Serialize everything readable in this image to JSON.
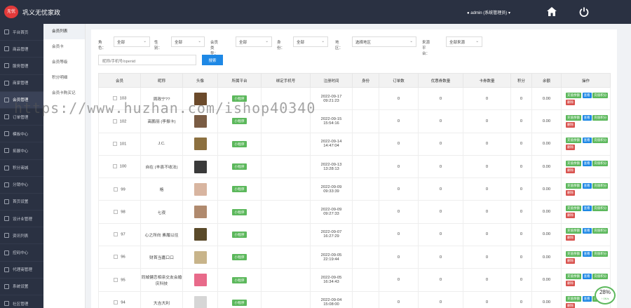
{
  "header": {
    "logo_text": "无忧",
    "brand": "巩义无忧家政",
    "admin": "admin (系统管理员)",
    "home_icon": "home-icon",
    "power_icon": "power-icon"
  },
  "sidebar": {
    "items": [
      {
        "label": "平台首页"
      },
      {
        "label": "商品管理"
      },
      {
        "label": "服务管理"
      },
      {
        "label": "商家管理"
      },
      {
        "label": "会员管理"
      },
      {
        "label": "订单管理"
      },
      {
        "label": "模板中心"
      },
      {
        "label": "拓展中心"
      },
      {
        "label": "积分商城"
      },
      {
        "label": "分销中心"
      },
      {
        "label": "首页设置"
      },
      {
        "label": "设计业管理"
      },
      {
        "label": "资讯列表"
      },
      {
        "label": "控码中心"
      },
      {
        "label": "代理商管理"
      },
      {
        "label": "系统设置"
      },
      {
        "label": "社区管理"
      }
    ]
  },
  "subnav": {
    "items": [
      {
        "label": "会员列表"
      },
      {
        "label": "会员卡"
      },
      {
        "label": "会员等级"
      },
      {
        "label": "积分明细"
      },
      {
        "label": "会员卡购买记"
      }
    ]
  },
  "filters": {
    "role_label": "角色：",
    "role_value": "全部",
    "gender_label": "性别：",
    "gender_value": "全部",
    "member_type_label": "会员类型：",
    "member_type_value": "全部",
    "identity_label": "身份：",
    "identity_value": "全部",
    "region_label": "地区：",
    "region_value": "选择地区",
    "source_label": "来源平台：",
    "source_value": "全部来源",
    "search_placeholder": "昵称/手机号/openid",
    "search_button": "搜索"
  },
  "table": {
    "headers": [
      "会员",
      "昵称",
      "头像",
      "所属平台",
      "绑定手机号",
      "注册时间",
      "身份",
      "订单数",
      "优惠券数量",
      "卡券数量",
      "积分",
      "余额",
      "操作"
    ],
    "rows": [
      {
        "id": "103",
        "nick": "周政宁??",
        "avatar": "#6b4a2b",
        "platform": "小程序",
        "phone": "",
        "date": "2022-09-17",
        "time": "09:21:23",
        "identity": "",
        "orders": "0",
        "coupons": "0",
        "cards": "0",
        "points": "0",
        "balance": "0.00"
      },
      {
        "id": "102",
        "nick": "高鹏丽 (李振卡)",
        "avatar": "#7a5c44",
        "platform": "小程序",
        "phone": "",
        "date": "2022-09-15",
        "time": "15:54:16",
        "identity": "",
        "orders": "0",
        "coupons": "0",
        "cards": "0",
        "points": "0",
        "balance": "0.00"
      },
      {
        "id": "101",
        "nick": "J.C.",
        "avatar": "#8c7040",
        "platform": "小程序",
        "phone": "",
        "date": "2022-09-14",
        "time": "14:47:04",
        "identity": "",
        "orders": "0",
        "coupons": "0",
        "cards": "0",
        "points": "0",
        "balance": "0.00"
      },
      {
        "id": "100",
        "nick": "自在 (丰县不收法)",
        "avatar": "#3a3a3a",
        "platform": "小程序",
        "phone": "",
        "date": "2022-09-13",
        "time": "13:28:13",
        "identity": "",
        "orders": "0",
        "coupons": "0",
        "cards": "0",
        "points": "0",
        "balance": "0.00"
      },
      {
        "id": "99",
        "nick": "格",
        "avatar": "#d8b5a0",
        "platform": "小程序",
        "phone": "",
        "date": "2022-09-09",
        "time": "09:33:39",
        "identity": "",
        "orders": "0",
        "coupons": "0",
        "cards": "0",
        "points": "0",
        "balance": "0.00"
      },
      {
        "id": "98",
        "nick": "七夜",
        "avatar": "#b08a6e",
        "platform": "小程序",
        "phone": "",
        "date": "2022-09-09",
        "time": "09:27:33",
        "identity": "",
        "orders": "0",
        "coupons": "0",
        "cards": "0",
        "points": "0",
        "balance": "0.00"
      },
      {
        "id": "97",
        "nick": "心之所向 素履以往",
        "avatar": "#5a4a2a",
        "platform": "小程序",
        "phone": "",
        "date": "2022-09-07",
        "time": "16:27:29",
        "identity": "",
        "orders": "0",
        "coupons": "0",
        "cards": "0",
        "points": "0",
        "balance": "0.00"
      },
      {
        "id": "96",
        "nick": "财首当嘉口口",
        "avatar": "#c8b48a",
        "platform": "小程序",
        "phone": "",
        "date": "2022-09-05",
        "time": "22:19:44",
        "identity": "",
        "orders": "0",
        "coupons": "0",
        "cards": "0",
        "points": "0",
        "balance": "0.00"
      },
      {
        "id": "95",
        "nick": "同城健恋相亲交友会婚庆科技",
        "avatar": "#e86a8a",
        "platform": "小程序",
        "phone": "",
        "date": "2022-09-05",
        "time": "16:34:43",
        "identity": "",
        "orders": "0",
        "coupons": "0",
        "cards": "0",
        "points": "0",
        "balance": "0.00"
      },
      {
        "id": "94",
        "nick": "大吉大利",
        "avatar": "#d6d6d6",
        "platform": "小程序",
        "phone": "",
        "date": "2022-09-04",
        "time": "15:08:00",
        "identity": "",
        "orders": "0",
        "coupons": "0",
        "cards": "0",
        "points": "0",
        "balance": "0.00"
      }
    ],
    "op_recharge_balance": "充值余额",
    "op_view": "查看",
    "op_recharge_points": "充值积分",
    "op_delete": "删除"
  },
  "watermark": "https://www.huzhan.com/ishop40340",
  "speed_badge": {
    "percent": "28%",
    "speed": "↑ 0K/s"
  }
}
